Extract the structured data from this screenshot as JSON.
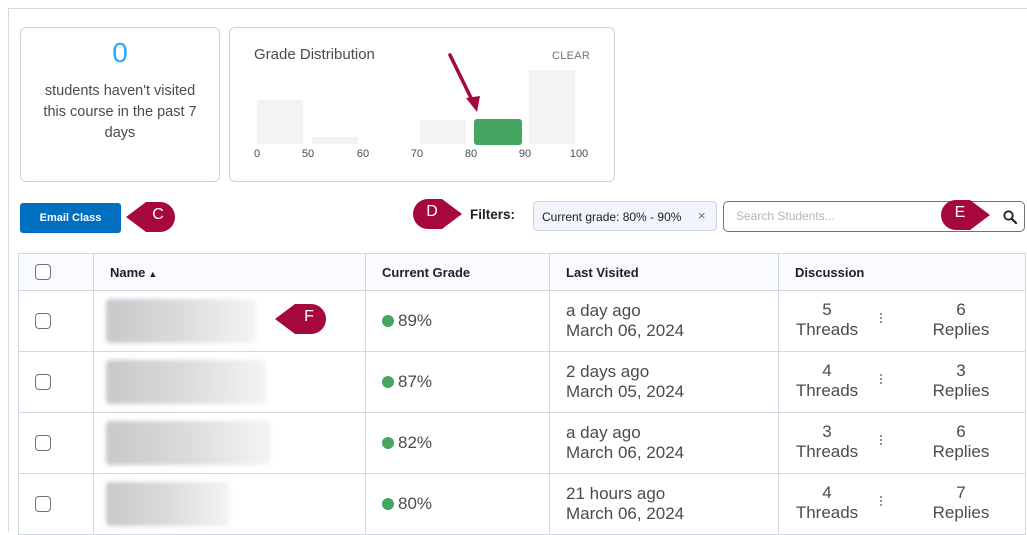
{
  "visits_card": {
    "count": "0",
    "text": "students haven't visited this course in the past 7 days"
  },
  "grade_distribution": {
    "title": "Grade Distribution",
    "clear_label": "CLEAR",
    "ticks": [
      "0",
      "50",
      "60",
      "70",
      "80",
      "90",
      "100"
    ]
  },
  "toolbar": {
    "email_button": "Email Class",
    "filters_label": "Filters:",
    "filter_chip": "Current grade: 80% - 90%",
    "filter_chip_remove": "×",
    "search_placeholder": "Search Students..."
  },
  "callouts": {
    "c": "C",
    "d": "D",
    "e": "E",
    "f": "F"
  },
  "table": {
    "headers": {
      "name": "Name",
      "grade": "Current Grade",
      "last_visited": "Last Visited",
      "discussion": "Discussion"
    },
    "rows": [
      {
        "grade": "89%",
        "visited_rel": "a day ago",
        "visited_date": "March 06, 2024",
        "threads": "5",
        "threads_label": "Threads",
        "replies": "6",
        "replies_label": "Replies"
      },
      {
        "grade": "87%",
        "visited_rel": "2 days ago",
        "visited_date": "March 05, 2024",
        "threads": "4",
        "threads_label": "Threads",
        "replies": "3",
        "replies_label": "Replies"
      },
      {
        "grade": "82%",
        "visited_rel": "a day ago",
        "visited_date": "March 06, 2024",
        "threads": "3",
        "threads_label": "Threads",
        "replies": "6",
        "replies_label": "Replies"
      },
      {
        "grade": "80%",
        "visited_rel": "21 hours ago",
        "visited_date": "March 06, 2024",
        "threads": "4",
        "threads_label": "Threads",
        "replies": "7",
        "replies_label": "Replies"
      }
    ]
  },
  "colors": {
    "accent": "#006fbf",
    "callout": "#a6083d",
    "grade_good": "#46a661",
    "count": "#29a6ff"
  }
}
